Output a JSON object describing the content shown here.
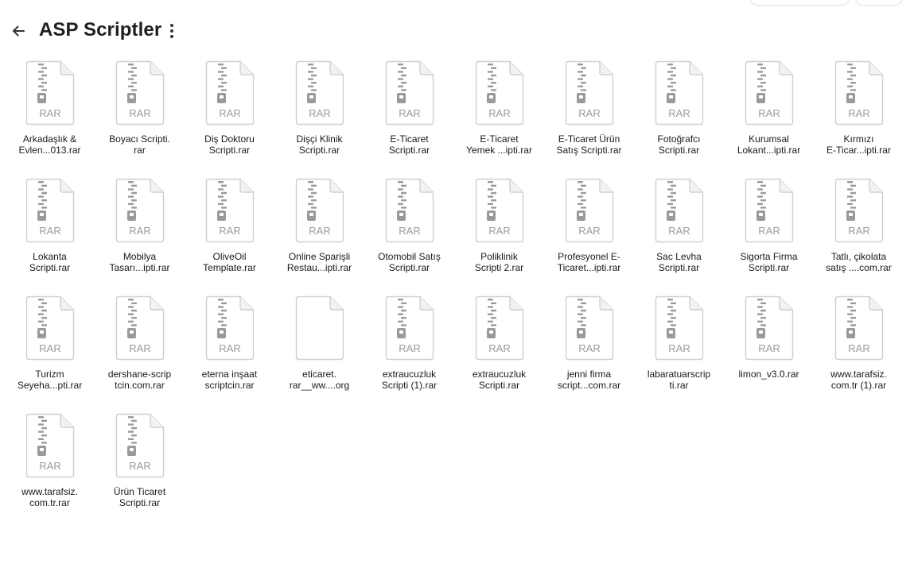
{
  "header": {
    "title": "ASP Scriptler",
    "back_icon": "arrow-left-icon",
    "more_icon": "more-vertical-icon"
  },
  "colors": {
    "icon_border": "#cfcfcf",
    "icon_gray": "#9a9a9a",
    "text": "#1a1a1a"
  },
  "files": [
    {
      "name": "Arkadaşlık &\nEvlen...013.rar",
      "type": "RAR",
      "icon": "rar-archive-icon"
    },
    {
      "name": "Boyacı Scripti.\nrar",
      "type": "RAR",
      "icon": "rar-archive-icon"
    },
    {
      "name": "Diş Doktoru\nScripti.rar",
      "type": "RAR",
      "icon": "rar-archive-icon"
    },
    {
      "name": "Dişçi Klinik\nScripti.rar",
      "type": "RAR",
      "icon": "rar-archive-icon"
    },
    {
      "name": "E-Ticaret\nScripti.rar",
      "type": "RAR",
      "icon": "rar-archive-icon"
    },
    {
      "name": "E-Ticaret\nYemek ...ipti.rar",
      "type": "RAR",
      "icon": "rar-archive-icon"
    },
    {
      "name": "E-Ticaret Ürün\nSatış Scripti.rar",
      "type": "RAR",
      "icon": "rar-archive-icon"
    },
    {
      "name": "Fotoğrafcı\nScripti.rar",
      "type": "RAR",
      "icon": "rar-archive-icon"
    },
    {
      "name": "Kurumsal\nLokant...ipti.rar",
      "type": "RAR",
      "icon": "rar-archive-icon"
    },
    {
      "name": "Kırmızı\nE-Ticar...ipti.rar",
      "type": "RAR",
      "icon": "rar-archive-icon"
    },
    {
      "name": "Lokanta\nScripti.rar",
      "type": "RAR",
      "icon": "rar-archive-icon"
    },
    {
      "name": "Mobilya\nTasarı...ipti.rar",
      "type": "RAR",
      "icon": "rar-archive-icon"
    },
    {
      "name": "OliveOil\nTemplate.rar",
      "type": "RAR",
      "icon": "rar-archive-icon"
    },
    {
      "name": "Online Sparişli\nRestau...ipti.rar",
      "type": "RAR",
      "icon": "rar-archive-icon"
    },
    {
      "name": "Otomobil Satış\nScripti.rar",
      "type": "RAR",
      "icon": "rar-archive-icon"
    },
    {
      "name": "Poliklinik\nScripti 2.rar",
      "type": "RAR",
      "icon": "rar-archive-icon"
    },
    {
      "name": "Profesyonel E-\nTicaret...ipti.rar",
      "type": "RAR",
      "icon": "rar-archive-icon"
    },
    {
      "name": "Sac Levha\nScripti.rar",
      "type": "RAR",
      "icon": "rar-archive-icon"
    },
    {
      "name": "Sigorta Firma\nScripti.rar",
      "type": "RAR",
      "icon": "rar-archive-icon"
    },
    {
      "name": "Tatlı, çikolata\nsatış ....com.rar",
      "type": "RAR",
      "icon": "rar-archive-icon"
    },
    {
      "name": "Turizm\nSeyeha...pti.rar",
      "type": "RAR",
      "icon": "rar-archive-icon"
    },
    {
      "name": "dershane-scrip\ntcin.com.rar",
      "type": "RAR",
      "icon": "rar-archive-icon"
    },
    {
      "name": "eterna inşaat\nscriptcin.rar",
      "type": "RAR",
      "icon": "rar-archive-icon"
    },
    {
      "name": "eticaret.\nrar__ww....org",
      "type": "",
      "icon": "blank-file-icon"
    },
    {
      "name": "extraucuzluk\nScripti (1).rar",
      "type": "RAR",
      "icon": "rar-archive-icon"
    },
    {
      "name": "extraucuzluk\nScripti.rar",
      "type": "RAR",
      "icon": "rar-archive-icon"
    },
    {
      "name": "jenni firma\nscript...com.rar",
      "type": "RAR",
      "icon": "rar-archive-icon"
    },
    {
      "name": "labaratuarscrip\nti.rar",
      "type": "RAR",
      "icon": "rar-archive-icon"
    },
    {
      "name": "limon_v3.0.rar",
      "type": "RAR",
      "icon": "rar-archive-icon"
    },
    {
      "name": "www.tarafsiz.\ncom.tr (1).rar",
      "type": "RAR",
      "icon": "rar-archive-icon"
    },
    {
      "name": "www.tarafsiz.\ncom.tr.rar",
      "type": "RAR",
      "icon": "rar-archive-icon"
    },
    {
      "name": "Ürün Ticaret\nScripti.rar",
      "type": "RAR",
      "icon": "rar-archive-icon"
    }
  ]
}
